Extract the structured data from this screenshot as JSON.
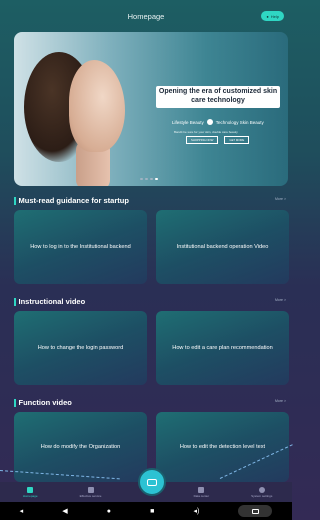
{
  "header": {
    "title": "Homepage",
    "badge": "Help"
  },
  "banner": {
    "headline": "Opening the era of customized skin care technology",
    "sub_left": "Lifestyle Beauty",
    "sub_right": "Technology Skin Beauty",
    "desc": "Bandit be sure for your skin, double care beauty",
    "btn_1": "SHOPPING NOW",
    "btn_2": "GET MORE"
  },
  "sections": [
    {
      "title": "Must-read guidance for startup",
      "more": "More >",
      "cards": [
        "How to log in to the Institutional backend",
        "Institutional backend operation Video"
      ]
    },
    {
      "title": "Instructional video",
      "more": "More >",
      "cards": [
        "How to change the login password",
        "How to edit a care plan recommendation"
      ]
    },
    {
      "title": "Function video",
      "more": "More >",
      "cards": [
        "How do modify the Organization",
        "How to edit the detection level text"
      ]
    }
  ],
  "tabbar": {
    "items": [
      {
        "label": "Homepage",
        "icon": "home-icon"
      },
      {
        "label": "Effective service",
        "icon": "service-icon"
      },
      {
        "label": "Data center",
        "icon": "data-icon"
      },
      {
        "label": "System settings",
        "icon": "settings-icon"
      }
    ]
  },
  "colors": {
    "accent": "#2fd6c3",
    "fab": "#2cc2d3"
  }
}
